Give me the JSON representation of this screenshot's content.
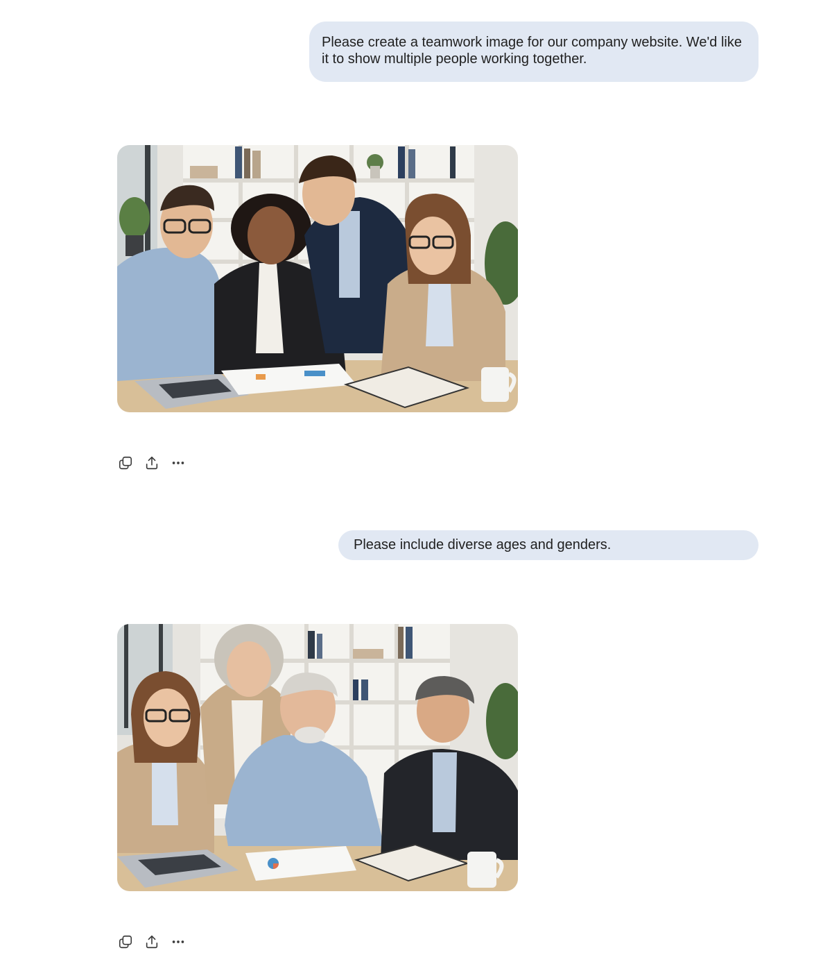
{
  "conversation": {
    "messages": [
      {
        "role": "user",
        "text": "Please create a teamwork image for our company website. We'd like it to show multiple people working together."
      },
      {
        "role": "assistant",
        "image": "teamwork-office-photo",
        "actions": [
          "copy-icon",
          "share-icon",
          "more-icon"
        ]
      },
      {
        "role": "user",
        "text": "Please include diverse ages and genders."
      },
      {
        "role": "assistant",
        "image": "diverse-team-office-photo",
        "actions": [
          "copy-icon",
          "share-icon",
          "more-icon"
        ]
      }
    ]
  },
  "colors": {
    "user_bubble": "#e1e8f3",
    "text": "#1f1f1f",
    "icon": "#3c3c3c"
  }
}
